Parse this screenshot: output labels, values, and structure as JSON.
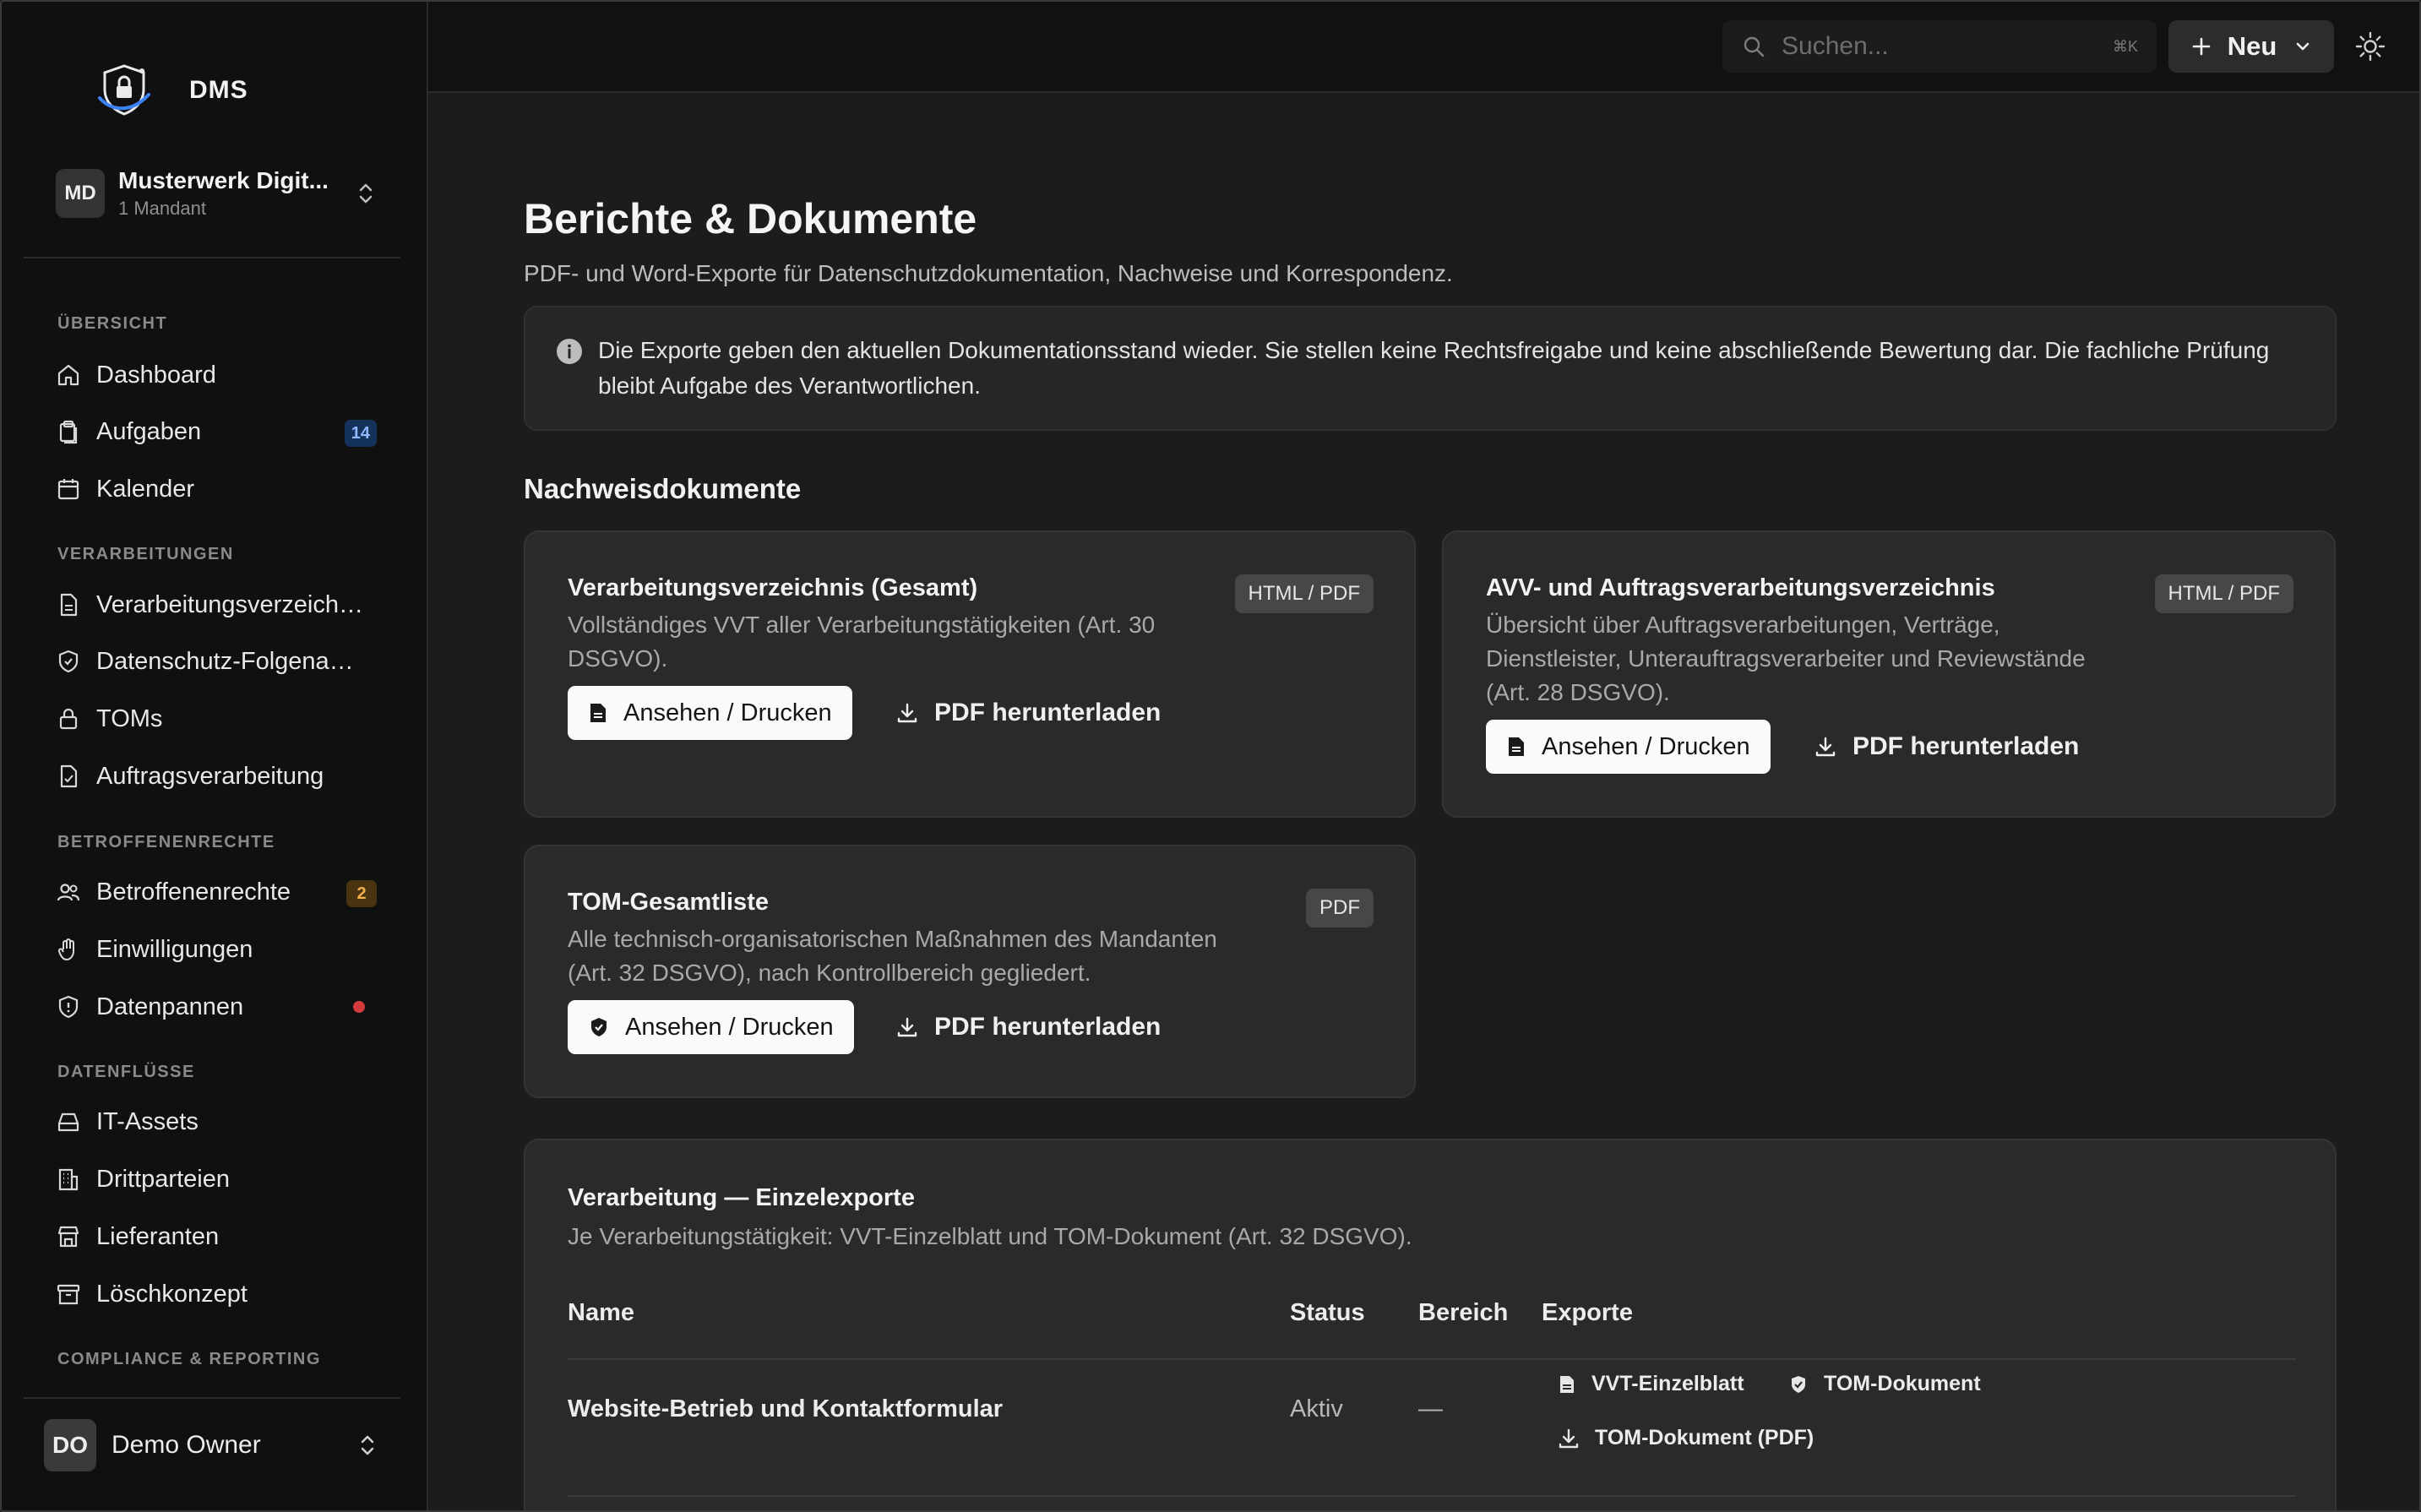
{
  "app": {
    "name": "DMS"
  },
  "tenant": {
    "initials": "MD",
    "name": "Musterwerk Digit...",
    "subtitle": "1 Mandant"
  },
  "sidebar": {
    "sections": [
      {
        "label": "ÜBERSICHT"
      },
      {
        "label": "VERARBEITUNGEN"
      },
      {
        "label": "BETROFFENENRECHTE"
      },
      {
        "label": "DATENFLÜSSE"
      },
      {
        "label": "COMPLIANCE & REPORTING"
      }
    ],
    "items": [
      {
        "label": "Dashboard",
        "icon": "home-icon"
      },
      {
        "label": "Aufgaben",
        "icon": "clipboard-icon",
        "badge": "14"
      },
      {
        "label": "Kalender",
        "icon": "calendar-icon"
      },
      {
        "label": "Verarbeitungsverzeichnis",
        "icon": "file-icon"
      },
      {
        "label": "Datenschutz-Folgenabschätzung",
        "icon": "shield-icon"
      },
      {
        "label": "TOMs",
        "icon": "lock-icon"
      },
      {
        "label": "Auftragsverarbeitung",
        "icon": "file-check-icon"
      },
      {
        "label": "Betroffenenrechte",
        "icon": "users-icon",
        "badge": "2"
      },
      {
        "label": "Einwilligungen",
        "icon": "hand-icon"
      },
      {
        "label": "Datenpannen",
        "icon": "shield-alert-icon",
        "indicator": "red-dot"
      },
      {
        "label": "IT-Assets",
        "icon": "hard-drive-icon"
      },
      {
        "label": "Drittparteien",
        "icon": "building-icon"
      },
      {
        "label": "Lieferanten",
        "icon": "store-icon"
      },
      {
        "label": "Löschkonzept",
        "icon": "archive-icon"
      }
    ]
  },
  "user": {
    "initials": "DO",
    "name": "Demo Owner"
  },
  "topbar": {
    "search_placeholder": "Suchen...",
    "search_shortcut": "⌘K",
    "new_label": "Neu"
  },
  "page": {
    "title": "Berichte & Dokumente",
    "subtitle": "PDF- und Word-Exporte für Datenschutzdokumentation, Nachweise und Korrespondenz.",
    "notice": "Die Exporte geben den aktuellen Dokumentationsstand wieder. Sie stellen keine Rechtsfreigabe und keine abschließende Bewertung dar. Die fachliche Prüfung bleibt Aufgabe des Verantwortlichen.",
    "section_title": "Nachweisdokumente"
  },
  "cards": [
    {
      "title": "Verarbeitungsverzeichnis (Gesamt)",
      "tag": "HTML / PDF",
      "desc_lines": [
        "Vollständiges VVT aller Verarbeitungstätigkeiten (Art. 30",
        "DSGVO)."
      ],
      "view_label": "Ansehen / Drucken",
      "download_label": "PDF herunterladen"
    },
    {
      "title": "AVV- und Auftragsverarbeitungsverzeichnis",
      "tag": "HTML / PDF",
      "desc_lines": [
        "Übersicht über Auftragsverarbeitungen, Verträge,",
        "Dienstleister, Unterauftragsverarbeiter und Reviewstände",
        "(Art. 28 DSGVO)."
      ],
      "view_label": "Ansehen / Drucken",
      "download_label": "PDF herunterladen"
    },
    {
      "title": "TOM-Gesamtliste",
      "tag": "PDF",
      "desc_lines": [
        "Alle technisch-organisatorischen Maßnahmen des Mandanten",
        "(Art. 32 DSGVO), nach Kontrollbereich gegliedert."
      ],
      "view_label": "Ansehen / Drucken",
      "download_label": "PDF herunterladen"
    }
  ],
  "exports_table": {
    "title": "Verarbeitung — Einzelexporte",
    "subtitle": "Je Verarbeitungstätigkeit: VVT-Einzelblatt und TOM-Dokument (Art. 32 DSGVO).",
    "columns": [
      "Name",
      "Status",
      "Bereich",
      "Exporte"
    ],
    "rows": [
      {
        "name": "Website-Betrieb und Kontaktformular",
        "status": "Aktiv",
        "area": "—",
        "exports": [
          "VVT-Einzelblatt",
          "TOM-Dokument",
          "TOM-Dokument (PDF)"
        ]
      }
    ]
  }
}
